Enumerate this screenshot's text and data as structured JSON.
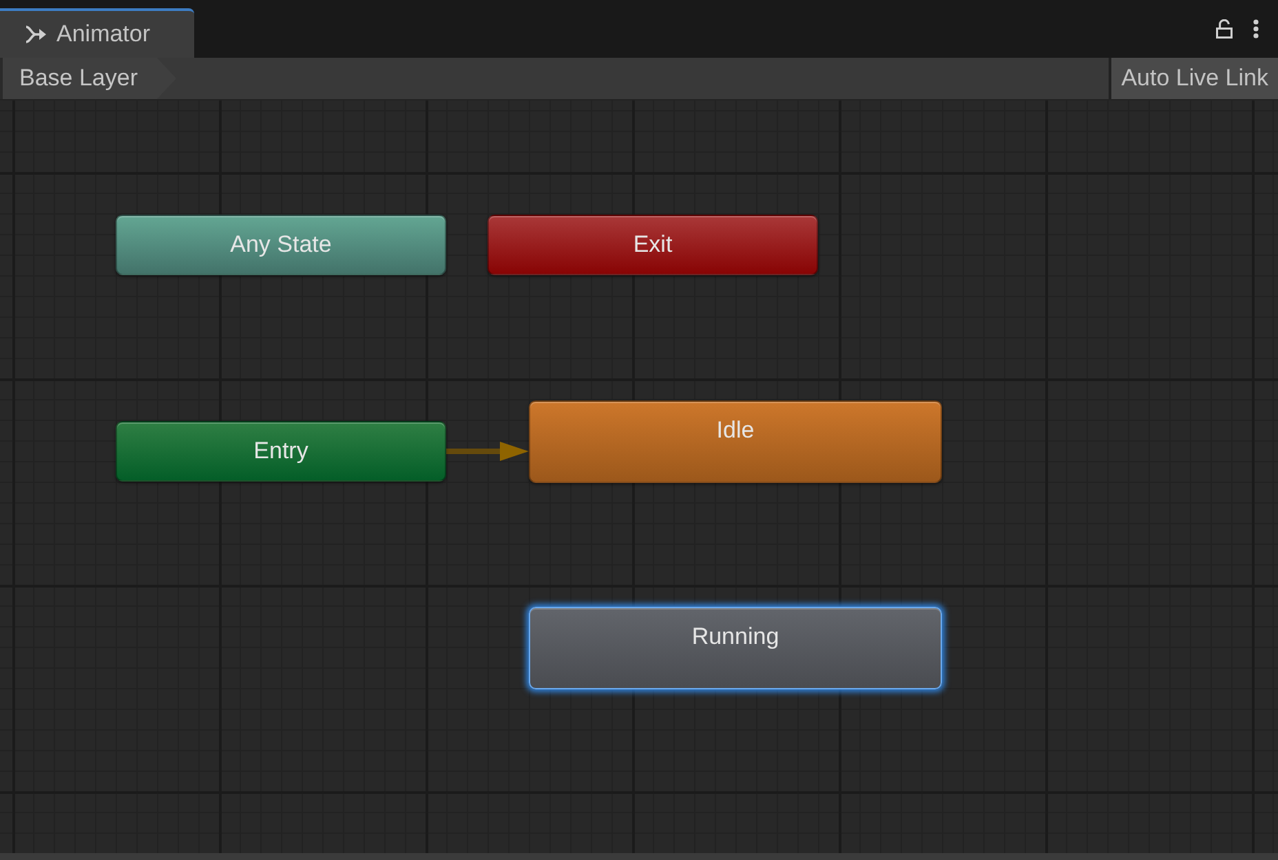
{
  "window": {
    "tab": {
      "label": "Animator",
      "selected": true
    }
  },
  "toolbar": {
    "breadcrumb": "Base Layer",
    "auto_live_link": "Auto Live Link"
  },
  "nodes": [
    {
      "label": "Any State",
      "kind": "any_state",
      "selected": false
    },
    {
      "label": "Exit",
      "kind": "exit",
      "selected": false
    },
    {
      "label": "Entry",
      "kind": "entry",
      "selected": false
    },
    {
      "label": "Idle",
      "kind": "state",
      "default": true,
      "selected": false
    },
    {
      "label": "Running",
      "kind": "state",
      "default": false,
      "selected": true
    }
  ]
}
